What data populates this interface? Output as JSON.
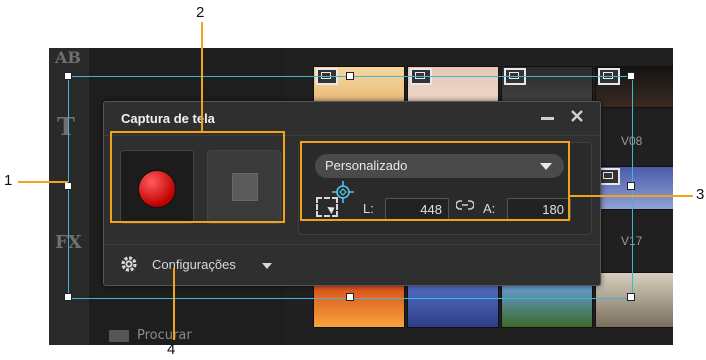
{
  "dialog": {
    "title": "Captura de tela",
    "minimize_icon": "minimize-icon",
    "close_icon": "close-icon",
    "record_icon": "record-dot-icon",
    "stop_icon": "stop-square-icon",
    "preset": {
      "selected": "Personalizado"
    },
    "width_label": "L:",
    "width_value": "448",
    "height_label": "A:",
    "height_value": "180",
    "settings_label": "Configurações"
  },
  "background": {
    "tools": [
      "AB",
      "T",
      "FX"
    ],
    "thumb_labels": [
      "V08",
      "V17"
    ],
    "browse_label": "Procurar"
  },
  "callouts": [
    "1",
    "2",
    "3",
    "4"
  ],
  "colors": {
    "accent_orange": "#f3a31b",
    "region_cyan": "#3fb6d6",
    "record_red": "#d10000"
  }
}
